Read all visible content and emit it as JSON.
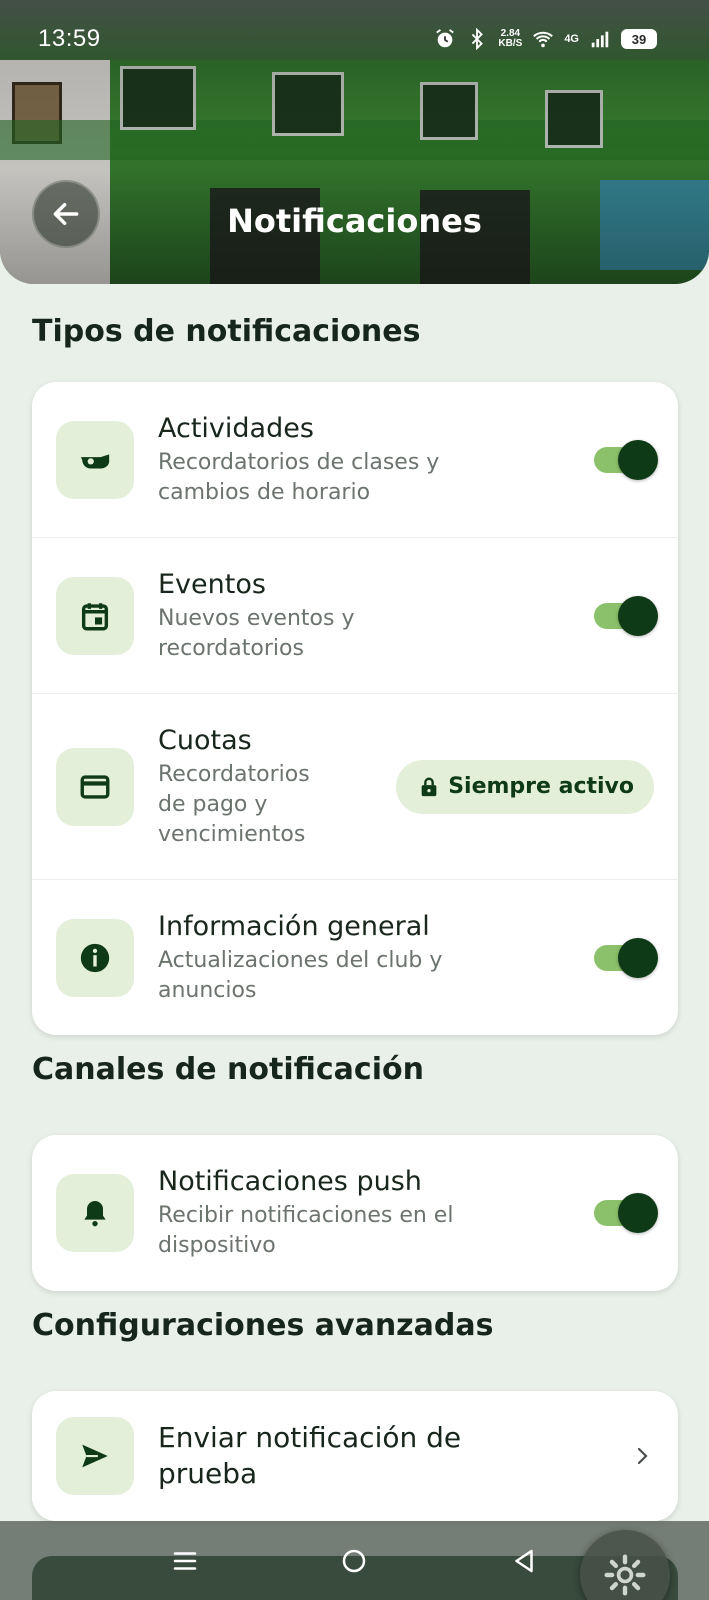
{
  "status_bar": {
    "time": "13:59",
    "net_speed_value": "2.84",
    "net_speed_unit": "KB/S",
    "network": "4G",
    "battery": "39"
  },
  "header": {
    "title": "Notificaciones"
  },
  "sections": {
    "types_title": "Tipos de notificaciones",
    "channels_title": "Canales de notificación",
    "advanced_title": "Configuraciones avanzadas"
  },
  "types": [
    {
      "title": "Actividades",
      "subtitle_1": "Recordatorios de clases y",
      "subtitle_2": "cambios de horario",
      "icon": "whistle-icon",
      "enabled": true
    },
    {
      "title": "Eventos",
      "subtitle_1": "Nuevos eventos y",
      "subtitle_2": "recordatorios",
      "icon": "calendar-icon",
      "enabled": true
    },
    {
      "title": "Cuotas",
      "subtitle_1": "Recordatorios",
      "subtitle_2": "de pago y",
      "subtitle_3": "vencimientos",
      "icon": "credit-card-icon",
      "badge": "Siempre activo"
    },
    {
      "title": "Información general",
      "subtitle_1": "Actualizaciones del club y",
      "subtitle_2": "anuncios",
      "icon": "info-icon",
      "enabled": true
    }
  ],
  "channels": [
    {
      "title": "Notificaciones push",
      "subtitle_1": "Recibir notificaciones en el",
      "subtitle_2": "dispositivo",
      "icon": "bell-icon",
      "enabled": true
    }
  ],
  "advanced": [
    {
      "title_1": "Enviar notificación de",
      "title_2": "prueba",
      "icon": "send-icon"
    }
  ],
  "colors": {
    "accent_dark": "#0f3a17",
    "toggle_track": "#8bc16a",
    "icon_bg": "#e3efd9",
    "background": "#e9efe9"
  }
}
